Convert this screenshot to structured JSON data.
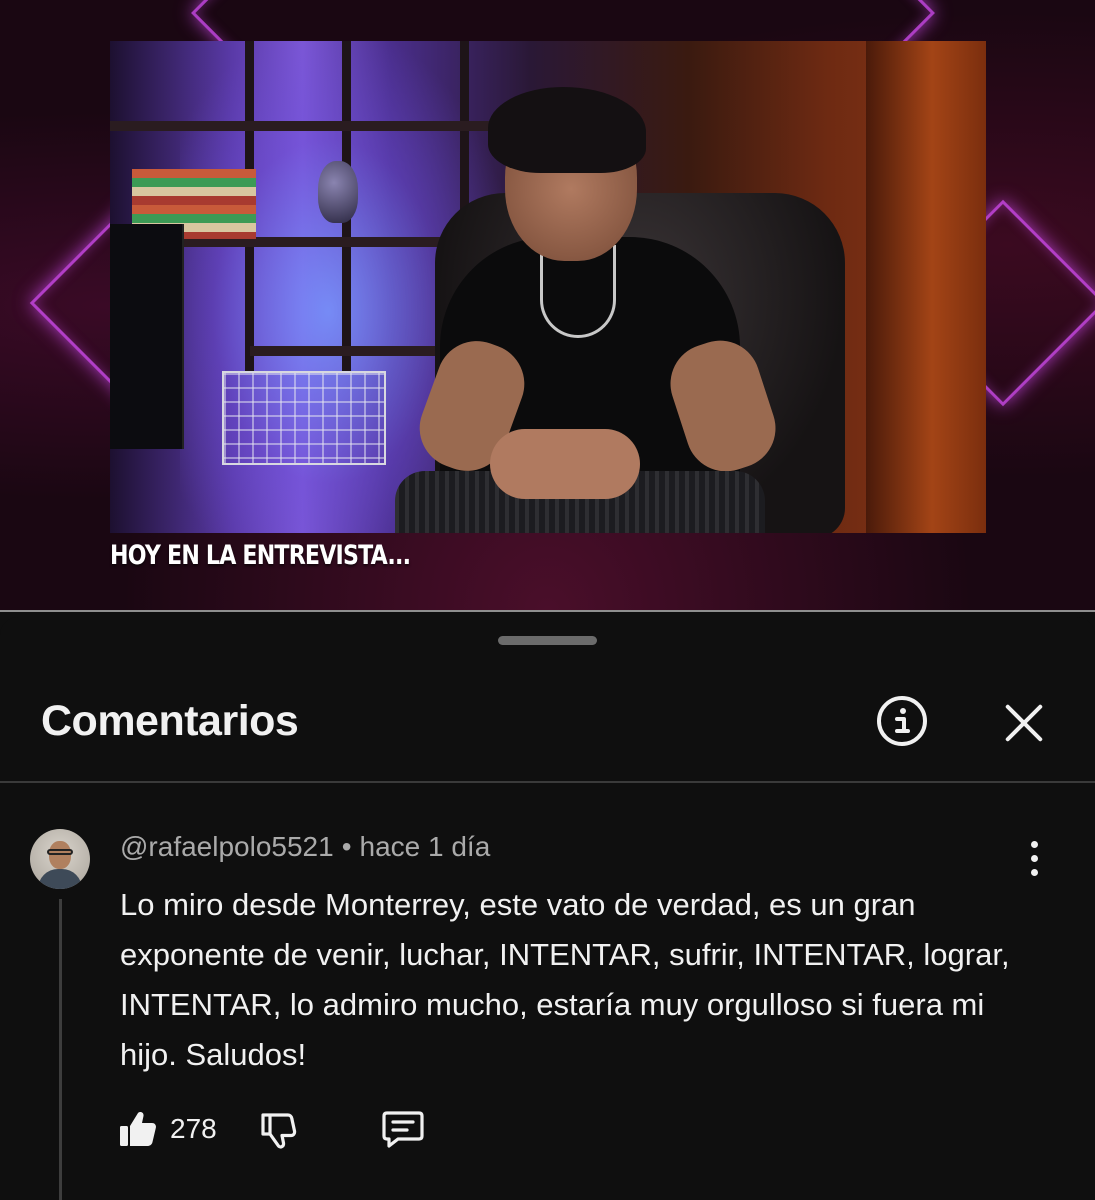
{
  "video": {
    "overlay_text": "HOY EN LA ENTREVISTA..."
  },
  "comments_panel": {
    "title": "Comentarios",
    "info_icon": "info-circle-icon",
    "close_icon": "close-icon"
  },
  "comment": {
    "author": "@rafaelpolo5521",
    "separator": "•",
    "time": "hace 1 día",
    "text": "Lo miro desde Monterrey, este vato de verdad, es un gran exponente de venir, luchar, INTENTAR, sufrir, INTENTAR, lograr, INTENTAR, lo admiro mucho, estaría muy orgulloso si fuera mi hijo. Saludos!",
    "likes": "278",
    "like_icon": "thumbs-up-icon",
    "dislike_icon": "thumbs-down-icon",
    "reply_icon": "reply-comment-icon",
    "menu_icon": "more-vert-icon"
  },
  "colors": {
    "background": "#0f0f0f",
    "text_primary": "#f1f1f1",
    "text_secondary": "#aaaaaa",
    "divider": "#3a3a3a"
  }
}
